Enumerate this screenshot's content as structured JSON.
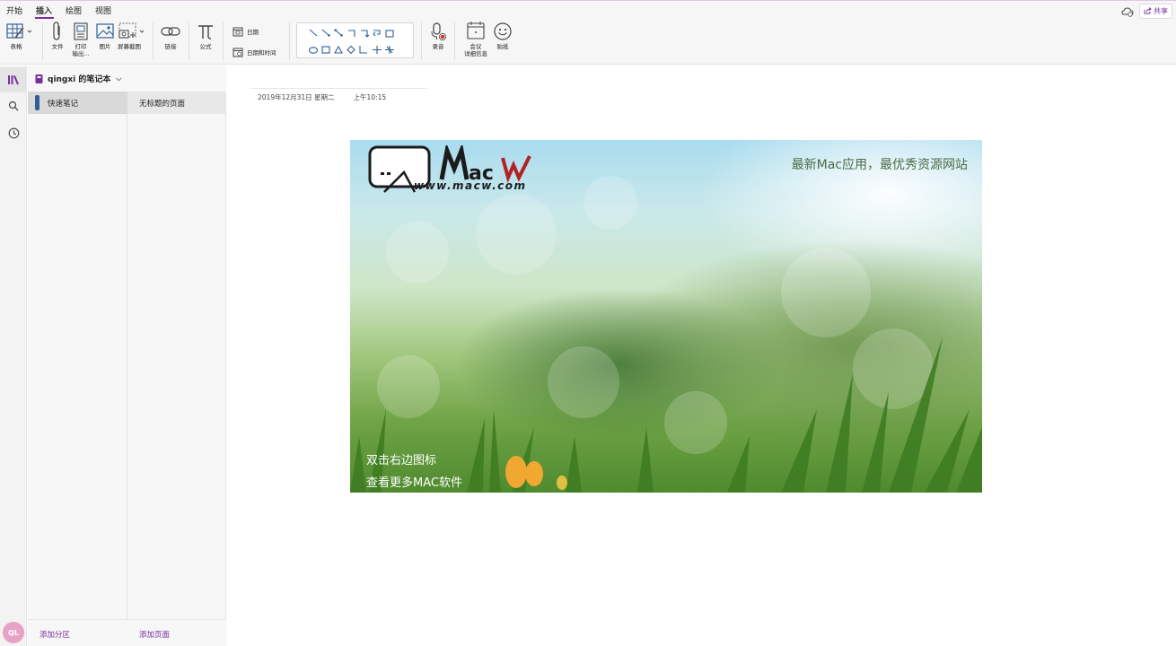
{
  "ribbon": {
    "tabs": [
      "开始",
      "插入",
      "绘图",
      "视图"
    ],
    "active_tab": "插入",
    "share_label": "共享",
    "tools": {
      "table": "表格",
      "file": "文件",
      "printout_line1": "打印",
      "printout_line2": "输出...",
      "picture": "图片",
      "screenshot": "屏幕截图",
      "link": "链接",
      "equation": "公式",
      "date": "日期",
      "datetime": "日期和时间",
      "record": "录音",
      "meeting_line1": "会议",
      "meeting_line2": "详细信息",
      "sticker": "贴纸"
    }
  },
  "notebook": {
    "title": "qingxi 的笔记本",
    "section": "快速笔记",
    "page": "无标题的页面",
    "add_section": "添加分区",
    "add_page": "添加页面",
    "user_initials": "QL"
  },
  "page": {
    "date": "2019年12月31日 星期二",
    "time": "上午10:15"
  },
  "banner": {
    "brand": "MacW",
    "url": "www.macw.com",
    "tagline": "最新Mac应用，最优秀资源网站",
    "line1": "双击右边图标",
    "line2": "查看更多MAC软件"
  },
  "colors": {
    "accent": "#7a2f9f",
    "section_bar": "#2f5f98",
    "avatar": "#e6a3c5"
  }
}
